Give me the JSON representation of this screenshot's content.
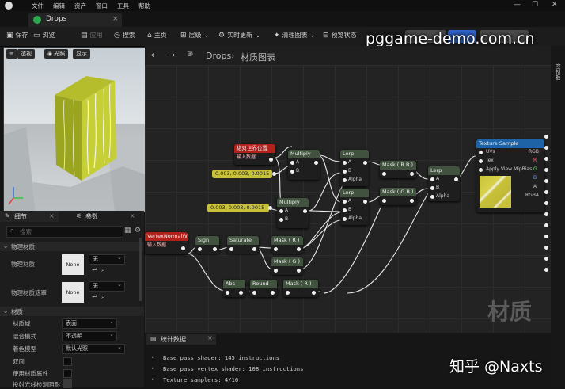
{
  "menu": [
    "文件",
    "编辑",
    "资产",
    "窗口",
    "工具",
    "帮助"
  ],
  "tab": {
    "label": "Drops",
    "close": "×"
  },
  "window": {
    "minimize": "—",
    "maximize": "☐",
    "close": "✕"
  },
  "toolbar": {
    "save": "保存",
    "browse": "浏览",
    "apply": "应用",
    "search": "搜索",
    "home": "主页",
    "hierarchy": "层级",
    "live_update": "实时更新",
    "clean_graph": "清理图表",
    "preview_state": "预览状态"
  },
  "watermark": "pggame-demo.com.cn",
  "viewport": {
    "perspective": "透视",
    "lit": "光照",
    "show": "显示"
  },
  "panel": {
    "details_tab": "细节",
    "params_tab": "参数",
    "search_placeholder": "搜索"
  },
  "physics": {
    "section": "物理材质",
    "phys_mat_label": "物理材质",
    "phys_mat_value": "无",
    "mask_label": "物理材质遮罩",
    "mask_value": "无",
    "swatch": "None"
  },
  "material": {
    "section": "材质",
    "rows": [
      {
        "label": "材质域",
        "value": "表面"
      },
      {
        "label": "混合模式",
        "value": "不透明"
      },
      {
        "label": "着色模型",
        "value": "默认光照"
      },
      {
        "label": "双面"
      },
      {
        "label": "使用材质属性"
      },
      {
        "label": "投射光线检测阴影"
      }
    ]
  },
  "breadcrumb": {
    "asset": "Drops",
    "separator": "›",
    "view": "材质图表"
  },
  "side_tab": "控制板",
  "graph_word": "材质",
  "nodes": {
    "world_pos": {
      "title": "绝对世界位置",
      "sub": "输入数据"
    },
    "const1": "0.003, 0.003, 0.0015",
    "const2": "0.003, 0.003, 0.0015",
    "multiply1": "Multiply",
    "multiply2": "Multiply",
    "vertex_normal": {
      "title": "VertexNormalWS",
      "sub": "输入数据"
    },
    "lerp1": "Lerp",
    "lerp2": "Lerp",
    "lerp3": "Lerp",
    "mask_rb": "Mask ( R B )",
    "mask_gb": "Mask ( G B )",
    "sign": "Sign",
    "saturate": "Saturate",
    "mask_r1": "Mask ( R )",
    "mask_g": "Mask ( G )",
    "abs": "Abs",
    "round": "Round",
    "mask_r2": "Mask ( R )",
    "pins": {
      "a": "A",
      "b": "B",
      "alpha": "Alpha"
    },
    "texture": {
      "title": "Texture Sample",
      "inputs": [
        "UVs",
        "Tex",
        "Apply View MipBias"
      ],
      "outputs": [
        "RGB",
        "R",
        "G",
        "B",
        "A",
        "RGBA"
      ]
    }
  },
  "stats": {
    "tab": "统计数据",
    "lines": [
      "Base pass shader: 145 instructions",
      "Base pass vertex shader: 108 instructions",
      "Texture samplers: 4/16"
    ]
  },
  "signature": "知乎 @Naxts"
}
